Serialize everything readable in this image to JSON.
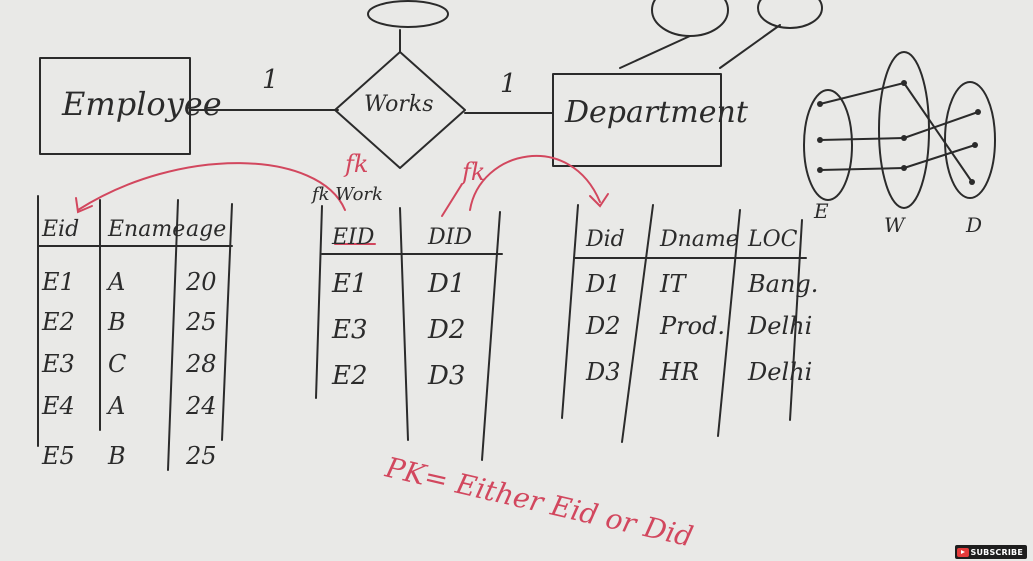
{
  "er": {
    "entity_left": "Employee",
    "relationship": "Works",
    "entity_right": "Department",
    "card_left": "1",
    "card_right": "1"
  },
  "sets": {
    "e": "E",
    "w": "W",
    "d": "D"
  },
  "fk": {
    "label_1": "fk",
    "label_2": "fk",
    "works_note": "fk Work"
  },
  "tables": {
    "employee": {
      "headers": [
        "Eid",
        "Ename",
        "age"
      ],
      "rows": [
        [
          "E1",
          "A",
          "20"
        ],
        [
          "E2",
          "B",
          "25"
        ],
        [
          "E3",
          "C",
          "28"
        ],
        [
          "E4",
          "A",
          "24"
        ],
        [
          "E5",
          "B",
          "25"
        ]
      ]
    },
    "works": {
      "headers": [
        "EID",
        "DID"
      ],
      "rows": [
        [
          "E1",
          "D1"
        ],
        [
          "E3",
          "D2"
        ],
        [
          "E2",
          "D3"
        ]
      ]
    },
    "department": {
      "headers": [
        "Did",
        "Dname",
        "LOC"
      ],
      "rows": [
        [
          "D1",
          "IT",
          "Bang."
        ],
        [
          "D2",
          "Prod.",
          "Delhi"
        ],
        [
          "D3",
          "HR",
          "Delhi"
        ]
      ]
    }
  },
  "pk_note": "PK= Either Eid or Did",
  "subscribe": "SUBSCRIBE",
  "colors": {
    "board": "#e9e9e7",
    "ink": "#2b2b2b",
    "marker_red": "#d2475e"
  }
}
